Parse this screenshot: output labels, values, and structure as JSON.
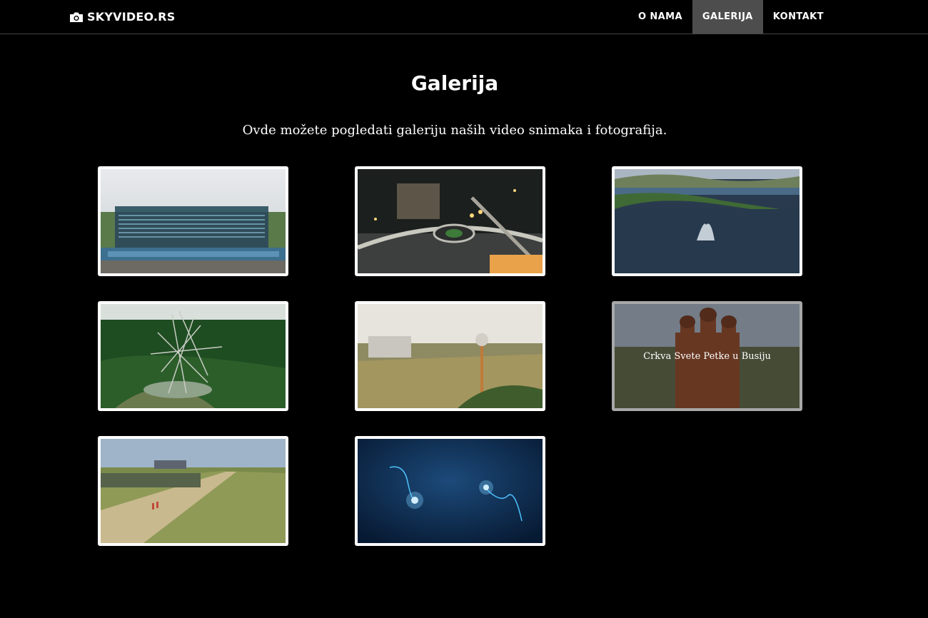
{
  "header": {
    "brand": "SKYVIDEO.RS",
    "brand_icon": "camera-icon",
    "nav": [
      {
        "label": "O NAMA",
        "active": false
      },
      {
        "label": "GALERIJA",
        "active": true
      },
      {
        "label": "KONTAKT",
        "active": false
      }
    ]
  },
  "main": {
    "title": "Galerija",
    "subtitle": "Ovde možete pogledati galeriju naših video snimaka i fotografija."
  },
  "gallery": [
    {
      "scene": "hotel-building"
    },
    {
      "scene": "night-roundabout"
    },
    {
      "scene": "lake-fountain"
    },
    {
      "scene": "tower-sculpture-forest"
    },
    {
      "scene": "water-tower-field"
    },
    {
      "scene": "church",
      "caption": "Crkva Svete Petke u Busiju",
      "hovered": true
    },
    {
      "scene": "racetrack"
    },
    {
      "scene": "space-stars"
    }
  ],
  "colors": {
    "background": "#000000",
    "nav_active": "#4d4d4d",
    "thumb_border": "#ffffff",
    "thumb_border_hover": "#a8a8a8"
  }
}
